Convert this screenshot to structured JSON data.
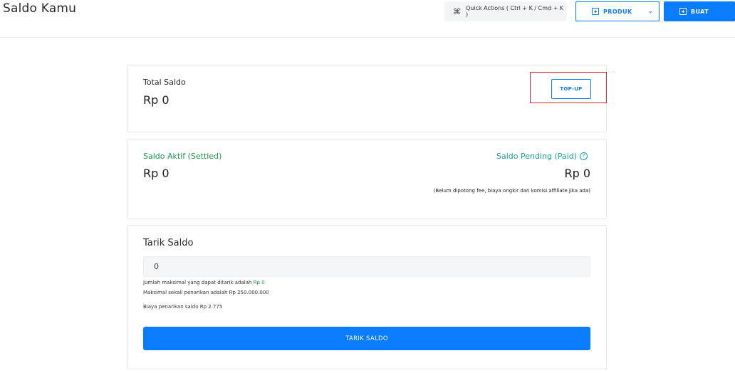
{
  "header": {
    "title": "Saldo Kamu",
    "quick_actions_label": "Quick Actions ( Ctrl + K / Cmd + K )",
    "produk_label": "PRODUK",
    "buat_label": "BUAT"
  },
  "balance": {
    "total_label": "Total Saldo",
    "total_amount": "Rp 0",
    "topup_label": "TOP-UP"
  },
  "status": {
    "aktif_label": "Saldo Aktif (Settled)",
    "aktif_amount": "Rp 0",
    "pending_label": "Saldo Pending (Paid)",
    "pending_amount": "Rp 0",
    "pending_note": "(Belum dipotong fee, biaya ongkir dan komisi affiliate jika ada)"
  },
  "withdraw": {
    "title": "Tarik Saldo",
    "input_value": "0",
    "info_max_prefix": "Jumlah maksimal yang dapat ditarik adalah",
    "info_max_value": "Rp 0",
    "info_limit": "Maksimal sekali penarikan adalah Rp 250.000.000",
    "info_fee": "Biaya penarikan saldo Rp 2.775",
    "button_label": "TARIK SALDO"
  },
  "colors": {
    "primary": "#0a7cff",
    "green": "#1a9a48",
    "teal": "#17a0a6",
    "highlight": "#e0262e"
  }
}
